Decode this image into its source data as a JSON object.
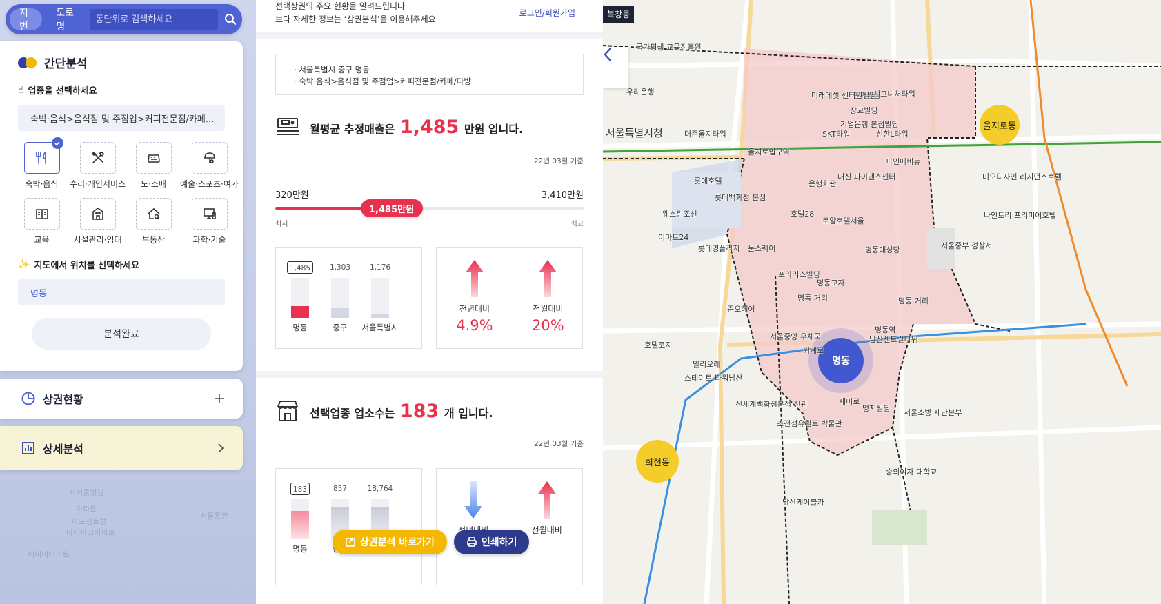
{
  "search": {
    "tab_jibun": "지번",
    "tab_road": "도로명",
    "placeholder": "동단위로 검색하세요"
  },
  "quick": {
    "title": "간단분석",
    "step1": "업종을 선택하세요",
    "selected_industry": "숙박·음식>음식점 및 주점업>커피전문점/카페...",
    "categories": [
      {
        "label": "숙박·음식",
        "icon": "fork-knife-icon",
        "selected": true
      },
      {
        "label": "수리·개인서비스",
        "icon": "tools-icon",
        "selected": false
      },
      {
        "label": "도·소매",
        "icon": "register-icon",
        "selected": false
      },
      {
        "label": "예술·스포츠·여가",
        "icon": "leisure-icon",
        "selected": false
      },
      {
        "label": "교육",
        "icon": "book-icon",
        "selected": false
      },
      {
        "label": "시설관리·임대",
        "icon": "building-icon",
        "selected": false
      },
      {
        "label": "부동산",
        "icon": "house-search-icon",
        "selected": false
      },
      {
        "label": "과학·기술",
        "icon": "monitor-icon",
        "selected": false
      }
    ],
    "step2": "지도에서 위치를 선택하세요",
    "location": "명동",
    "done": "분석완료"
  },
  "status_section": "상권현황",
  "detail_section": "상세분석",
  "intro": {
    "line1": "선택상권의 주요 현황을 알려드립니다",
    "line2_a": "보다 자세한 정보는 ‘",
    "line2_em": "상권분석",
    "line2_b": "’을 이용해주세요",
    "login": "로그인",
    "slash": "/",
    "signup": "회원가입"
  },
  "selection": {
    "area": "서울특별시 중구 명동",
    "industry": "숙박·음식>음식점 및 주점업>커피전문점/카페/다방"
  },
  "sales": {
    "prefix": "월평균 추정매출은",
    "value": "1,485",
    "suffix": "만원 입니다.",
    "ref": "22년 03월 기준",
    "min_label": "320만원",
    "max_label": "3,410만원",
    "thumb_label": "1,485만원",
    "min_caption": "최저",
    "max_caption": "최고",
    "min": 320,
    "max": 3410,
    "current": 1485,
    "compare": [
      {
        "value": "1,485",
        "label": "명동",
        "ratio": 0.29,
        "highlight": true
      },
      {
        "value": "1,303",
        "label": "중구",
        "ratio": 0.25,
        "highlight": false
      },
      {
        "value": "1,176",
        "label": "서울특별시",
        "ratio": 0.09,
        "highlight": false
      }
    ],
    "yoy_label": "전년대비",
    "yoy_value": "4.9%",
    "mom_label": "전월대비",
    "mom_value": "20%"
  },
  "stores": {
    "prefix": "선택업종 업소수는",
    "value": "183",
    "suffix": "개 입니다.",
    "ref": "22년 03월 기준",
    "compare": [
      {
        "value": "183",
        "label": "명동",
        "ratio": 0.7,
        "highlight": true
      },
      {
        "value": "857",
        "label": "중구",
        "ratio": 0.8,
        "highlight": false
      },
      {
        "value": "18,764",
        "label": "서울특별시",
        "ratio": 0.8,
        "highlight": false
      }
    ],
    "yoy_label": "전년대비",
    "mom_label": "전월대비"
  },
  "buttons": {
    "go_analysis": "상권분석 바로가기",
    "print": "인쇄하기"
  },
  "map": {
    "top_tag": "북창동",
    "selected_dong": "명동",
    "yellow_dongs": [
      "을지로동",
      "회현동"
    ],
    "labels": [
      {
        "t": "서울특별시청"
      },
      {
        "t": "더존을지타워"
      },
      {
        "t": "SKT타워"
      },
      {
        "t": "롯데호텔"
      },
      {
        "t": "롯데백화점 본점"
      },
      {
        "t": "웨스틴조선"
      },
      {
        "t": "이마트24"
      },
      {
        "t": "롯데영플라자"
      },
      {
        "t": "눈스퀘어"
      },
      {
        "t": "호텔28"
      },
      {
        "t": "로얄호텔서울"
      },
      {
        "t": "은행회관"
      },
      {
        "t": "대신 파이낸스센터"
      },
      {
        "t": "신한L타워"
      },
      {
        "t": "한화빌딩"
      },
      {
        "t": "장교빌딩"
      },
      {
        "t": "기업은행 본점빌딩"
      },
      {
        "t": "파인에비뉴"
      },
      {
        "t": "명동대성당"
      },
      {
        "t": "서울중부 경찰서"
      },
      {
        "t": "명동교자"
      },
      {
        "t": "명동 거리"
      },
      {
        "t": "포라리스빌딩"
      },
      {
        "t": "준오헤어"
      },
      {
        "t": "서울중앙 우체국"
      },
      {
        "t": "밀리오레"
      },
      {
        "t": "스테이트 타워남산"
      },
      {
        "t": "신세계백화점본점 신관"
      },
      {
        "t": "남산센트럴타워"
      },
      {
        "t": "재미로"
      },
      {
        "t": "명지빌딩"
      },
      {
        "t": "서울소방 재난본부"
      },
      {
        "t": "숭의여자 대학교"
      },
      {
        "t": "초전섬유퀼트 박물관"
      },
      {
        "t": "남산케이블카"
      },
      {
        "t": "퇴계로"
      },
      {
        "t": "을지로입구역"
      },
      {
        "t": "명동역"
      },
      {
        "t": "호텔코지"
      },
      {
        "t": "우리은행"
      },
      {
        "t": "국가평생 교육진흥원"
      },
      {
        "t": "시그니처타워"
      },
      {
        "t": "미래에셋 센터원빌딩"
      },
      {
        "t": "나인트리 프리미어호텔"
      },
      {
        "t": "미오디자인 레지던스호텔"
      },
      {
        "t": "명동 거리"
      }
    ]
  }
}
